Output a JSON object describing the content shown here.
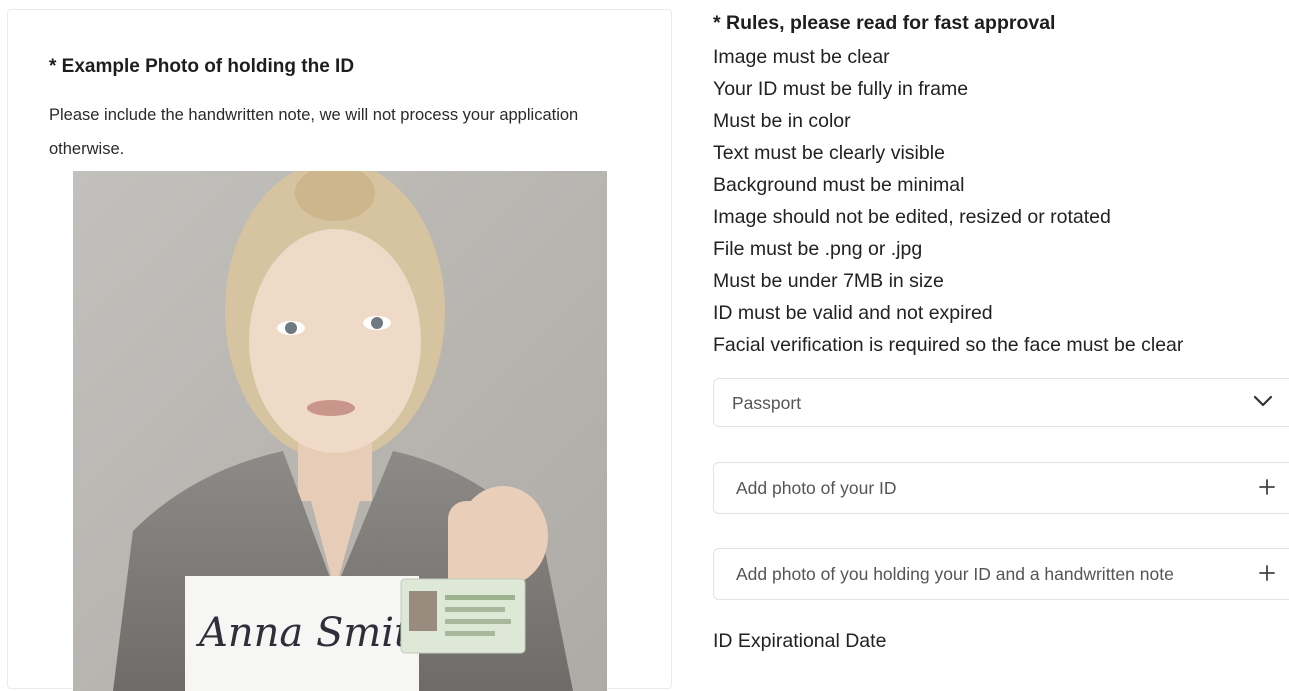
{
  "example": {
    "title": "* Example Photo of holding the ID",
    "description": "Please include the handwritten note, we will not process your application otherwise.",
    "photo_note_text": "Anna Smith"
  },
  "rules": {
    "title": "* Rules, please read for fast approval",
    "items": [
      "Image must be clear",
      "Your ID must be fully in frame",
      "Must be in color",
      "Text must be clearly visible",
      "Background must be minimal",
      "Image should not be edited, resized or rotated",
      "File must be .png or .jpg",
      "Must be under 7MB in size",
      "ID must be valid and not expired",
      "Facial verification is required so the face must be clear"
    ]
  },
  "id_type_select": {
    "value": "Passport",
    "icon": "chevron-down-icon"
  },
  "uploads": [
    {
      "label": "Add photo of your ID",
      "icon": "plus-icon"
    },
    {
      "label": "Add photo of you holding your ID and a handwritten note",
      "icon": "plus-icon"
    }
  ],
  "expiration": {
    "label": "ID Expirational Date"
  },
  "colors": {
    "border": "#e3e3e3",
    "text": "#222222",
    "muted_text": "#555555"
  }
}
